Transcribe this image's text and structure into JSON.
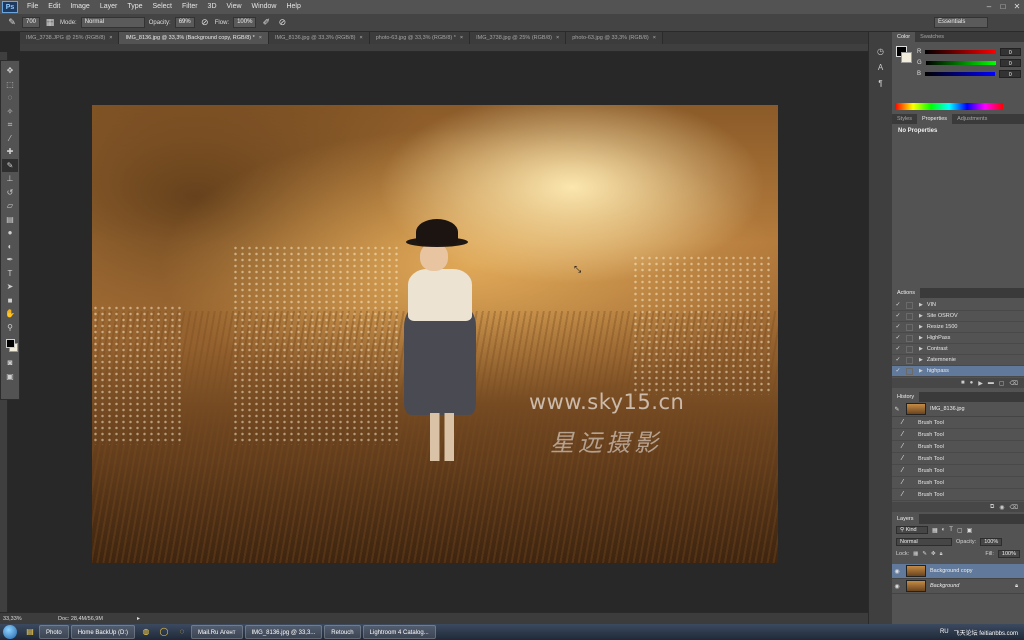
{
  "menu": {
    "logo": "Ps",
    "items": [
      "File",
      "Edit",
      "Image",
      "Layer",
      "Type",
      "Select",
      "Filter",
      "3D",
      "View",
      "Window",
      "Help"
    ]
  },
  "options_bar": {
    "brush_size": "700",
    "mode_label": "Mode:",
    "mode_value": "Normal",
    "opacity_label": "Opacity:",
    "opacity_value": "69%",
    "flow_label": "Flow:",
    "flow_value": "100%",
    "workspace": "Essentials"
  },
  "doc_tabs": [
    {
      "label": "IMG_3738.JPG @ 25% (RGB/8)",
      "active": false
    },
    {
      "label": "IMG_8136.jpg @ 33,3% (Background copy, RGB/8) *",
      "active": true
    },
    {
      "label": "IMG_8136.jpg @ 33,3% (RGB/8)",
      "active": false
    },
    {
      "label": "photo-63.jpg @ 33,3% (RGB/8) *",
      "active": false
    },
    {
      "label": "IMG_3738.jpg @ 25% (RGB/8)",
      "active": false
    },
    {
      "label": "photo-63.jpg @ 33,3% (RGB/8)",
      "active": false
    }
  ],
  "canvas": {
    "watermark_url": "www.sky15.cn",
    "watermark_cn": "星远摄影"
  },
  "status": {
    "zoom": "33,33%",
    "doc": "Doc: 28,4M/56,9M"
  },
  "color_panel": {
    "tabs": [
      "Color",
      "Swatches"
    ],
    "rows": [
      {
        "label": "R",
        "value": "0",
        "color": "#e03030"
      },
      {
        "label": "G",
        "value": "0",
        "color": "#30c030"
      },
      {
        "label": "B",
        "value": "0",
        "color": "#3050e0"
      }
    ]
  },
  "properties_panel": {
    "tabs": [
      "Styles",
      "Properties",
      "Adjustments"
    ],
    "content": "No Properties"
  },
  "actions_panel": {
    "title": "Actions",
    "items": [
      "VIN",
      "Site OSROV",
      "Resize 1500",
      "HighPass",
      "Contrast",
      "Zatemnenie",
      "highpass"
    ]
  },
  "history_panel": {
    "title": "History",
    "snapshot": "IMG_8136.jpg",
    "items": [
      "Brush Tool",
      "Brush Tool",
      "Brush Tool",
      "Brush Tool",
      "Brush Tool",
      "Brush Tool",
      "Brush Tool",
      "Brush Tool"
    ]
  },
  "layers_panel": {
    "title": "Layers",
    "kind": "Kind",
    "blend": "Normal",
    "opacity_label": "Opacity:",
    "opacity": "100%",
    "lock_label": "Lock:",
    "fill_label": "Fill:",
    "fill": "100%",
    "layers": [
      {
        "name": "Background copy",
        "selected": true
      },
      {
        "name": "Background",
        "selected": false
      }
    ]
  },
  "taskbar": {
    "items": [
      "Photo",
      "Home BackUp (D:)",
      "Mail.Ru Агент",
      "IMG_8136.jpg @ 33,3...",
      "Retouch",
      "Lightroom 4 Catalog..."
    ],
    "lang": "RU",
    "tray_text": "飞天论坛 feitianbbs.com"
  }
}
